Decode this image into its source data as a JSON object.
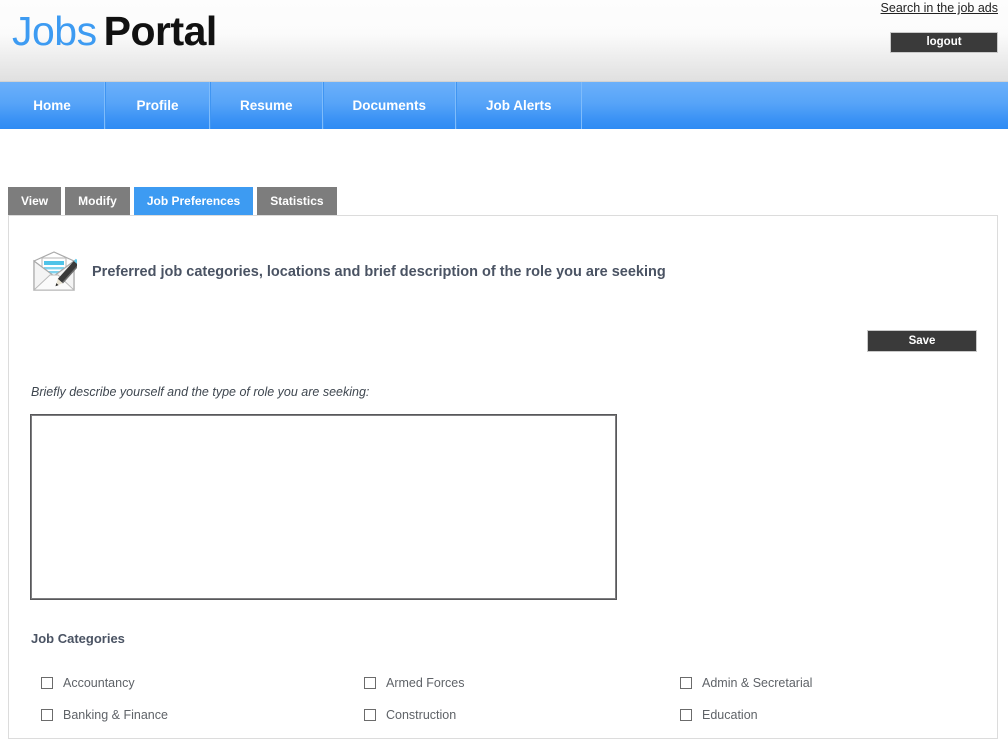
{
  "header": {
    "logo_primary": "Jobs",
    "logo_secondary": "Portal",
    "search_link": "Search in the job ads",
    "logout_label": "logout",
    "accent_blue": "#3d9bf2",
    "dark_button": "#3a3a3a"
  },
  "nav": {
    "items": [
      {
        "label": "Home"
      },
      {
        "label": "Profile"
      },
      {
        "label": "Resume"
      },
      {
        "label": "Documents"
      },
      {
        "label": "Job Alerts"
      }
    ]
  },
  "tabs": [
    {
      "label": "View",
      "active": false
    },
    {
      "label": "Modify",
      "active": false
    },
    {
      "label": "Job Preferences",
      "active": true
    },
    {
      "label": "Statistics",
      "active": false
    }
  ],
  "panel": {
    "icon": "envelope-pencil-icon",
    "title": "Preferred job categories, locations and brief description of the role you are seeking",
    "save_label": "Save",
    "description_label": "Briefly describe yourself and the type of role you are seeking:",
    "description_value": "",
    "description_placeholder": "",
    "categories_title": "Job Categories",
    "categories": [
      {
        "label": "Accountancy",
        "checked": false
      },
      {
        "label": "Armed Forces",
        "checked": false
      },
      {
        "label": "Admin & Secretarial",
        "checked": false
      },
      {
        "label": "Banking & Finance",
        "checked": false
      },
      {
        "label": "Construction",
        "checked": false
      },
      {
        "label": "Education",
        "checked": false
      }
    ]
  }
}
